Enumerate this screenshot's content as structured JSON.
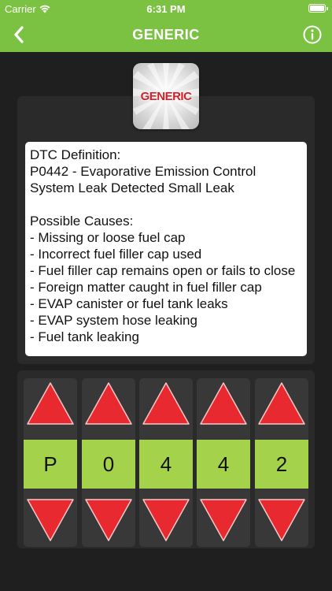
{
  "status_bar": {
    "carrier": "Carrier",
    "time": "6:31 PM"
  },
  "nav": {
    "title": "GENERIC"
  },
  "logo": {
    "text": "GENERIC"
  },
  "definition": {
    "lines": [
      "DTC Definition:",
      "P0442 - Evaporative Emission Control System Leak Detected Small Leak",
      "",
      "Possible Causes:",
      "- Missing or loose fuel cap",
      "- Incorrect fuel filler cap used",
      "- Fuel filler cap remains open or fails to close",
      "- Foreign matter caught in fuel filler cap",
      "- EVAP canister or fuel tank leaks",
      "- EVAP system hose leaking",
      "- Fuel tank leaking"
    ]
  },
  "code": {
    "digits": [
      "P",
      "0",
      "4",
      "4",
      "2"
    ]
  },
  "colors": {
    "accent_green": "#7cc242",
    "digit_green": "#a4d24b",
    "arrow_red": "#e8292f",
    "logo_red": "#d52027"
  },
  "icons": {
    "back": "chevron-left-icon",
    "info": "info-icon",
    "wifi": "wifi-icon",
    "battery": "battery-icon",
    "up": "triangle-up-icon",
    "down": "triangle-down-icon"
  }
}
